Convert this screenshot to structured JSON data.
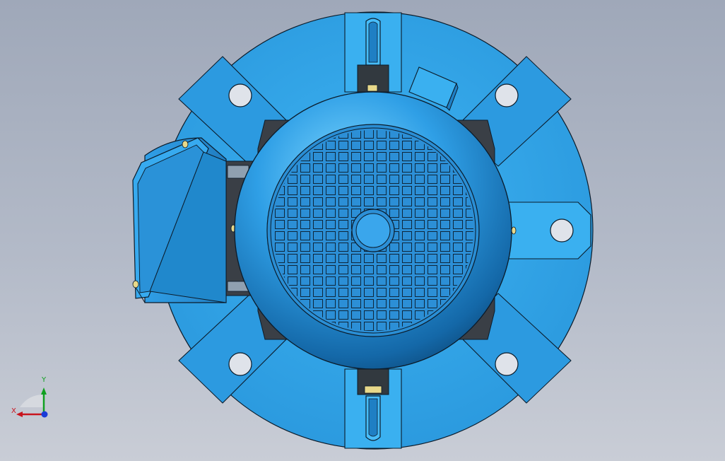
{
  "viewport": {
    "background_top": "#9fa8b9",
    "background_bottom": "#c9cdd6"
  },
  "model": {
    "body_color": "#36aaee",
    "body_dark": "#1b6fae",
    "outline": "#0b1b2a",
    "fan_grille_color": "#2c8fd6",
    "bolt_color": "#e8d98a",
    "dark_part_color": "#3a3f46"
  },
  "triad": {
    "x_label": "X",
    "y_label": "Y",
    "x_color": "#c8141e",
    "y_color": "#10a020",
    "z_color": "#1a3cd8"
  }
}
